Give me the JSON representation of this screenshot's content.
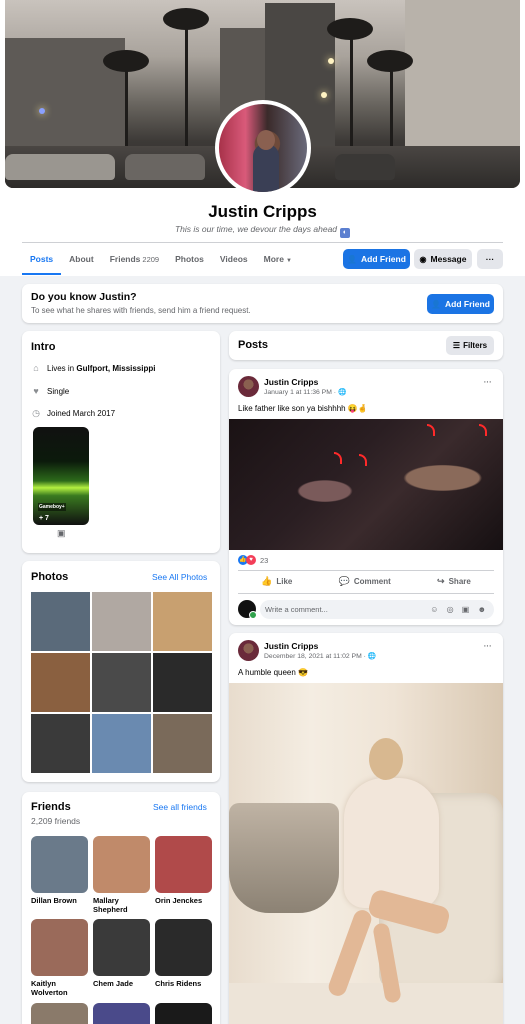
{
  "profile": {
    "name": "Justin Cripps",
    "bio": "This is our time, we devour the days ahead",
    "bio_flag_glyph": "◐"
  },
  "tabs": [
    {
      "label": "Posts",
      "active": true
    },
    {
      "label": "About"
    },
    {
      "label": "Friends",
      "count": "2209"
    },
    {
      "label": "Photos"
    },
    {
      "label": "Videos"
    },
    {
      "label": "More"
    }
  ],
  "header_buttons": {
    "add_friend": "Add Friend",
    "message": "Message",
    "more": "···"
  },
  "know_card": {
    "title": "Do you know Justin?",
    "subtitle": "To see what he shares with friends, send him a friend request.",
    "button": "Add Friend"
  },
  "intro": {
    "title": "Intro",
    "lives_prefix": "Lives in ",
    "lives_place": "Gulfport, Mississippi",
    "relationship": "Single",
    "joined": "Joined March 2017",
    "story_label": "Gameboy+",
    "story_count": "+ 7"
  },
  "photos": {
    "title": "Photos",
    "see_all": "See All Photos",
    "tiles": [
      "#5a6a7a",
      "#b0a8a2",
      "#c8a070",
      "#8a6040",
      "#4a4a4a",
      "#2a2a2a",
      "#3a3a3a",
      "#6a8ab0",
      "#7a6a5a"
    ]
  },
  "friends": {
    "title": "Friends",
    "see_all": "See all friends",
    "count_text": "2,209 friends",
    "list": [
      {
        "name": "Dillan Brown",
        "color": "#6a7a8a"
      },
      {
        "name": "Mallary Shepherd",
        "color": "#c08a6a"
      },
      {
        "name": "Orin Jenckes",
        "color": "#b04a4a"
      },
      {
        "name": "Kaitlyn Wolverton",
        "color": "#9a6a5a"
      },
      {
        "name": "Chem Jade",
        "color": "#3a3a3a"
      },
      {
        "name": "Chris Ridens",
        "color": "#2a2a2a"
      }
    ]
  },
  "posts_section": {
    "title": "Posts",
    "filters": "Filters"
  },
  "posts": [
    {
      "author": "Justin Cripps",
      "meta": "January 1 at 11:36 PM · ",
      "text": "Like father like son ya bishhhh 😝🤞",
      "reaction_count": "23",
      "like": "Like",
      "comment": "Comment",
      "share": "Share",
      "comment_placeholder": "Write a comment...",
      "comment_icons": "☺ ◎ ▣ ☻"
    },
    {
      "author": "Justin Cripps",
      "meta": "December 18, 2021 at 11:02 PM · ",
      "text": "A humble queen 😎"
    }
  ]
}
